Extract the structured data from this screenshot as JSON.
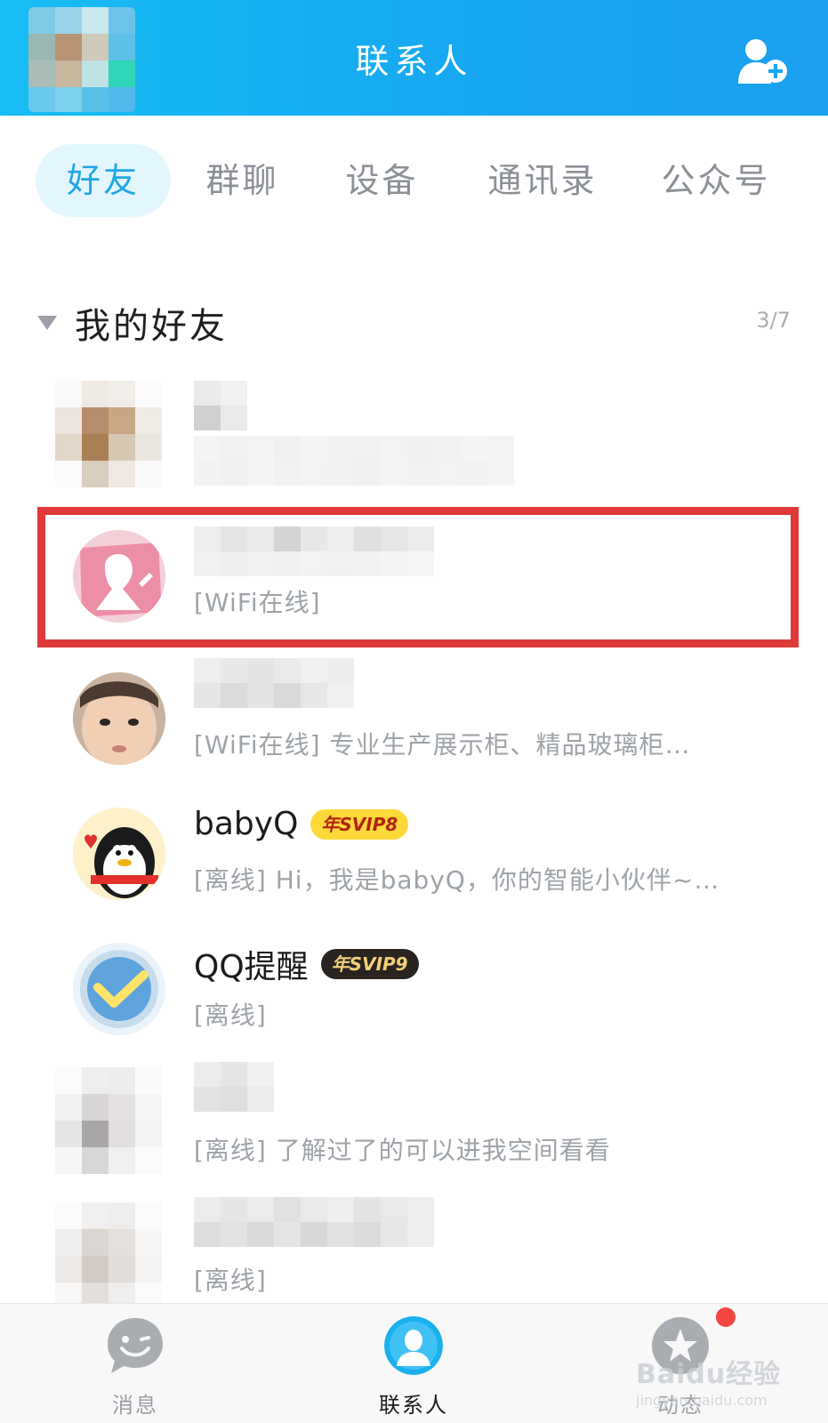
{
  "header": {
    "title": "联系人",
    "add_icon": "add-contact-icon"
  },
  "tabs": [
    {
      "label": "好友",
      "active": true
    },
    {
      "label": "群聊",
      "active": false
    },
    {
      "label": "设备",
      "active": false
    },
    {
      "label": "通讯录",
      "active": false
    },
    {
      "label": "公众号",
      "active": false
    }
  ],
  "group": {
    "name": "我的好友",
    "count": "3/7"
  },
  "friends": [
    {
      "name": "",
      "status": ""
    },
    {
      "name": "",
      "status": "[WiFi在线]"
    },
    {
      "name": "",
      "status": "[WiFi在线] 专业生产展示柜、精品玻璃柜…"
    },
    {
      "name": "babyQ",
      "badge": "年SVIP8",
      "status": "[离线] Hi，我是babyQ，你的智能小伙伴~…"
    },
    {
      "name": "QQ提醒",
      "badge": "年SVIP9",
      "status": "[离线]"
    },
    {
      "name": "",
      "status": "[离线] 了解过了的可以进我空间看看"
    },
    {
      "name": "",
      "status": "[离线]"
    }
  ],
  "bottom_nav": [
    {
      "label": "消息",
      "icon": "message-icon"
    },
    {
      "label": "联系人",
      "icon": "contacts-icon"
    },
    {
      "label": "动态",
      "icon": "moments-icon"
    }
  ],
  "watermark": {
    "brand": "Baidu经验",
    "url": "jingyan.baidu.com"
  },
  "colors": {
    "header_blue": "#17a6f2",
    "tab_active_text": "#20a7e6",
    "highlight_red": "#e0393a",
    "badge_svip8": "#ffd93a",
    "badge_svip9": "#2a2420"
  }
}
